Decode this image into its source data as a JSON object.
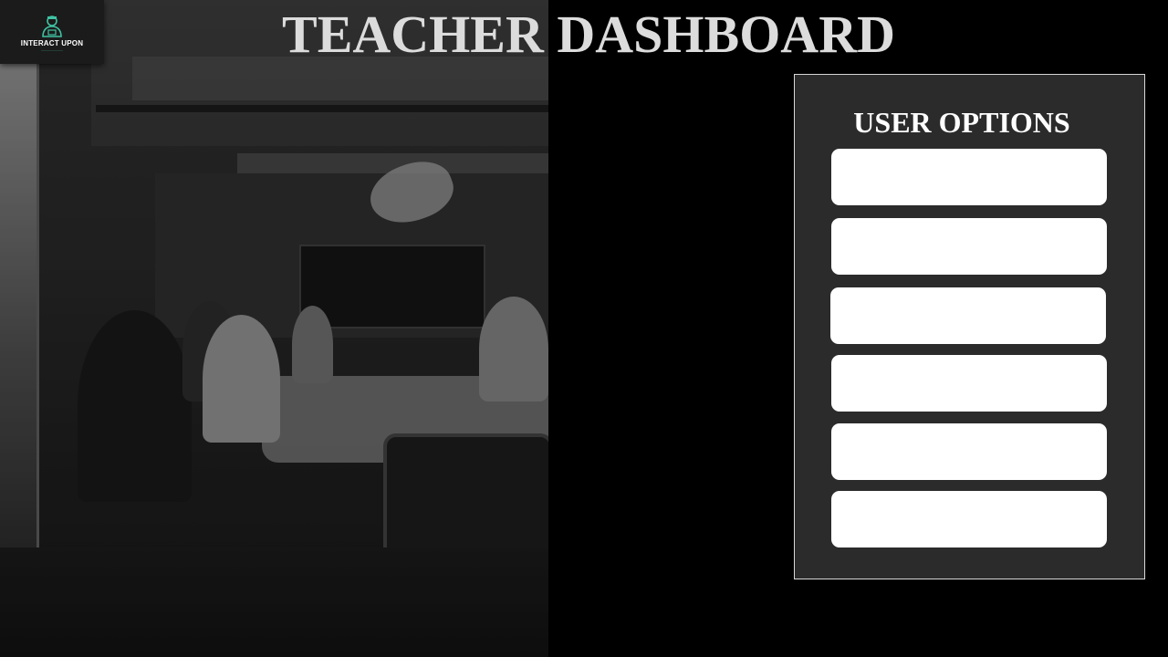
{
  "header": {
    "title": "TEACHER DASHBOARD"
  },
  "logo": {
    "name": "INTERACT UPON",
    "icon": "teacher-person-icon",
    "accent_color": "#3fc3a3"
  },
  "user_options": {
    "title": "USER OPTIONS",
    "buttons": [
      {
        "label": ""
      },
      {
        "label": ""
      },
      {
        "label": ""
      },
      {
        "label": ""
      },
      {
        "label": ""
      },
      {
        "label": ""
      }
    ]
  },
  "colors": {
    "background": "#000000",
    "panel": "#2b2b2b",
    "panel_border": "#d8d8d8",
    "button": "#ffffff",
    "title_text": "#dcdcdc"
  },
  "background_image": "grayscale-meeting-room-photo"
}
